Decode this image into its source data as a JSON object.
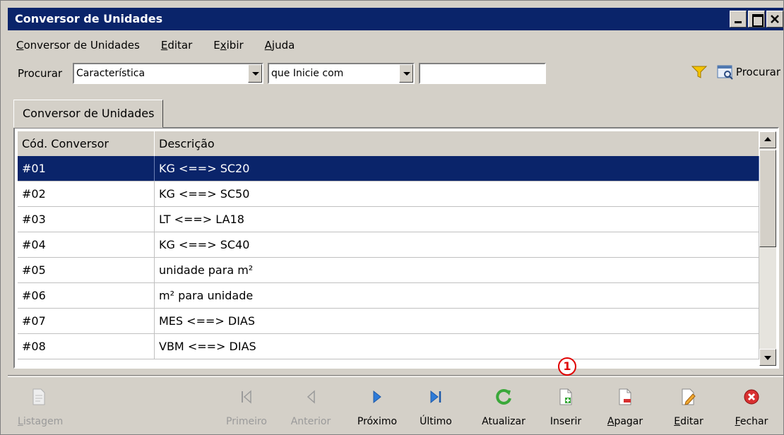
{
  "window": {
    "title": "Conversor de Unidades"
  },
  "menu": [
    {
      "label": "Conversor de Unidades"
    },
    {
      "label": "Editar"
    },
    {
      "label": "Exibir"
    },
    {
      "label": "Ajuda"
    }
  ],
  "search": {
    "label": "Procurar",
    "field_value": "Característica",
    "mode_value": "que Inicie com",
    "text_value": "",
    "button_label": "Procurar"
  },
  "tab": {
    "label": "Conversor de Unidades"
  },
  "table": {
    "columns": [
      "Cód. Conversor",
      "Descrição"
    ],
    "rows": [
      {
        "code": "#01",
        "desc": "KG <==> SC20"
      },
      {
        "code": "#02",
        "desc": "KG <==> SC50"
      },
      {
        "code": "#03",
        "desc": "LT <==> LA18"
      },
      {
        "code": "#04",
        "desc": "KG <==> SC40"
      },
      {
        "code": "#05",
        "desc": "unidade para m²"
      },
      {
        "code": "#06",
        "desc": "m² para unidade"
      },
      {
        "code": "#07",
        "desc": "MES <==> DIAS"
      },
      {
        "code": "#08",
        "desc": "VBM <==> DIAS"
      }
    ]
  },
  "toolbar": {
    "listagem": "Listagem",
    "primeiro": "Primeiro",
    "anterior": "Anterior",
    "proximo": "Próximo",
    "ultimo": "Último",
    "atualizar": "Atualizar",
    "inserir": "Inserir",
    "apagar": "Apagar",
    "editar": "Editar",
    "fechar": "Fechar"
  },
  "callout": {
    "number": "1"
  },
  "colors": {
    "titlebar": "#0a246a",
    "selection": "#0a246a",
    "callout": "#e00000"
  }
}
